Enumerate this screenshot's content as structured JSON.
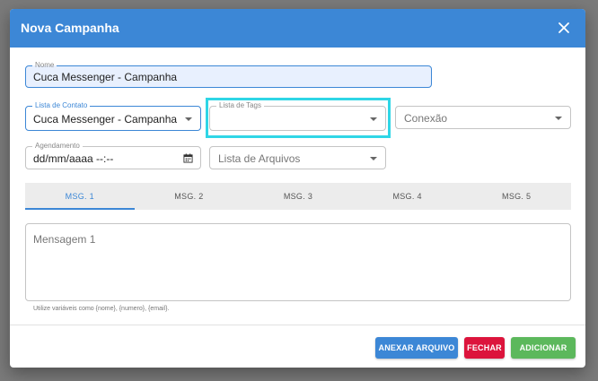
{
  "dialog": {
    "title": "Nova Campanha",
    "close_icon": "close-icon"
  },
  "fields": {
    "nome": {
      "label": "Nome",
      "value": "Cuca Messenger - Campanha"
    },
    "lista_contato": {
      "label": "Lista de Contato",
      "value": "Cuca Messenger - Campanha"
    },
    "lista_tags": {
      "label": "Lista de Tags",
      "value": ""
    },
    "conexao": {
      "placeholder": "Conexão"
    },
    "agendamento": {
      "label": "Agendamento",
      "value": "dd/mm/aaaa --:--",
      "icon": "calendar-icon"
    },
    "lista_arquivos": {
      "placeholder": "Lista de Arquivos"
    }
  },
  "tabs": [
    {
      "label": "MSG. 1",
      "active": true
    },
    {
      "label": "MSG. 2",
      "active": false
    },
    {
      "label": "MSG. 3",
      "active": false
    },
    {
      "label": "MSG. 4",
      "active": false
    },
    {
      "label": "MSG. 5",
      "active": false
    }
  ],
  "message": {
    "placeholder": "Mensagem 1",
    "helper": "Utilize variáveis como {nome}, {numero}, {email}."
  },
  "buttons": {
    "attach": "ANEXAR ARQUIVO",
    "close": "FECHAR",
    "add": "ADICIONAR"
  },
  "colors": {
    "primary": "#3c87d6",
    "danger": "#dc143c",
    "success": "#5cb85c",
    "highlight": "#2fd6e6"
  }
}
